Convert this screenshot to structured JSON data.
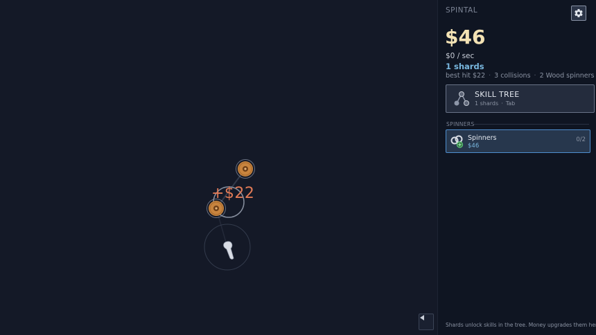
{
  "game": {
    "title": "SPINTAL",
    "float_text": "+$22"
  },
  "panel": {
    "money": "$46",
    "rate": "$0 / sec",
    "shards": "1 shards",
    "stats": {
      "best_hit": "best hit $22",
      "collisions": "3 collisions",
      "spinners": "2 Wood spinners"
    },
    "skill_tree": {
      "title": "SKILL TREE",
      "shards": "1 shards",
      "key": "Tab"
    },
    "section_label": "SPINNERS",
    "spinner_item": {
      "name": "Spinners",
      "cost": "$46",
      "count": "0/2"
    },
    "hint": "Shards unlock skills in the tree. Money upgrades them here."
  },
  "colors": {
    "background": "#141927",
    "panel": "#0f1522",
    "money": "#f3e2b4",
    "shards": "#79b8e0",
    "float_text": "#e07a56",
    "wood": "#c8843e",
    "card_border": "#4f8fd0"
  },
  "icons": {
    "settings": "gear-icon",
    "skill_tree": "skill-tree-nodes-icon",
    "spinners": "spinners-icon",
    "collapse": "triangle-left-icon"
  }
}
